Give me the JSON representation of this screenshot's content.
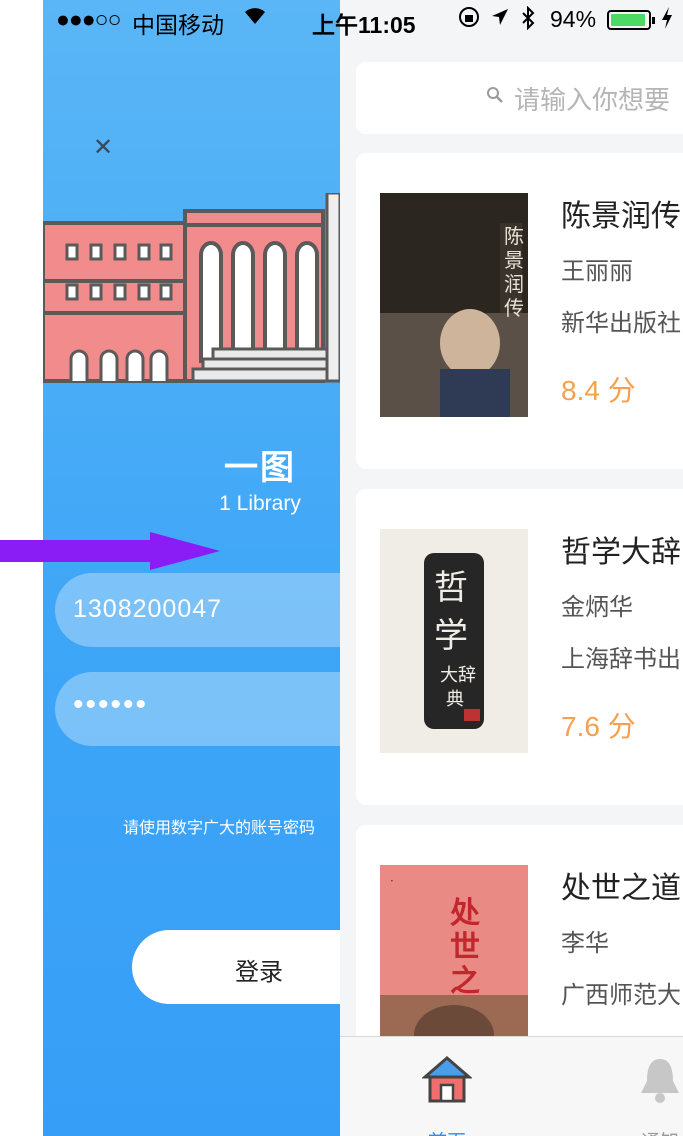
{
  "status_bar": {
    "signal": "●●●○○",
    "carrier": "中国移动",
    "time": "上午11:05",
    "battery": "94%"
  },
  "login": {
    "title": "一图",
    "subtitle": "1 Library",
    "phone_value": "1308200047",
    "password_value": "••••••",
    "hint": "请使用数字广大的账号密码",
    "login_label": "登录"
  },
  "search": {
    "placeholder": "请输入你想要"
  },
  "books": [
    {
      "title": "陈景润传",
      "author": "王丽丽",
      "publisher": "新华出版社",
      "rating": "8.4",
      "unit": "分"
    },
    {
      "title": "哲学大辞",
      "author": "金炳华",
      "publisher": "上海辞书出",
      "rating": "7.6",
      "unit": "分"
    },
    {
      "title": "处世之道",
      "author": "李华",
      "publisher": "广西师范大",
      "rating": "",
      "unit": ""
    }
  ],
  "tabbar": {
    "home": "首页",
    "notify": "通知"
  },
  "colors": {
    "login_bg": "#3ea6f7",
    "rating": "#f5a04a",
    "tab_active": "#2a8fe8",
    "arrow": "#8a1cf5"
  }
}
